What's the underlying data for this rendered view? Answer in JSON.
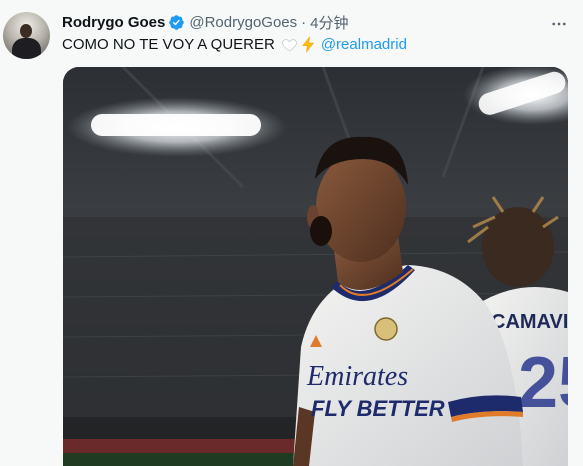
{
  "tweet": {
    "author_name": "Rodrygo Goes",
    "author_handle": "@RodrygoGoes",
    "separator": "·",
    "time": "4分钟",
    "text": "COMO NO TE VOY A QUERER",
    "emojis": [
      "white-heart-icon",
      "lightning-icon"
    ],
    "mention": "@realmadrid",
    "verified": true
  },
  "media": {
    "shirt_sponsor_line1": "Emirates",
    "shirt_sponsor_line2": "FLY BETTER",
    "teammate_name_on_shirt": "CAMAVINGA",
    "teammate_number_partial": "25"
  },
  "colors": {
    "link": "#1d9bf0",
    "verified": "#1d9bf0",
    "text_primary": "#0f1419",
    "text_secondary": "#536471",
    "background": "#f7f9f9"
  }
}
